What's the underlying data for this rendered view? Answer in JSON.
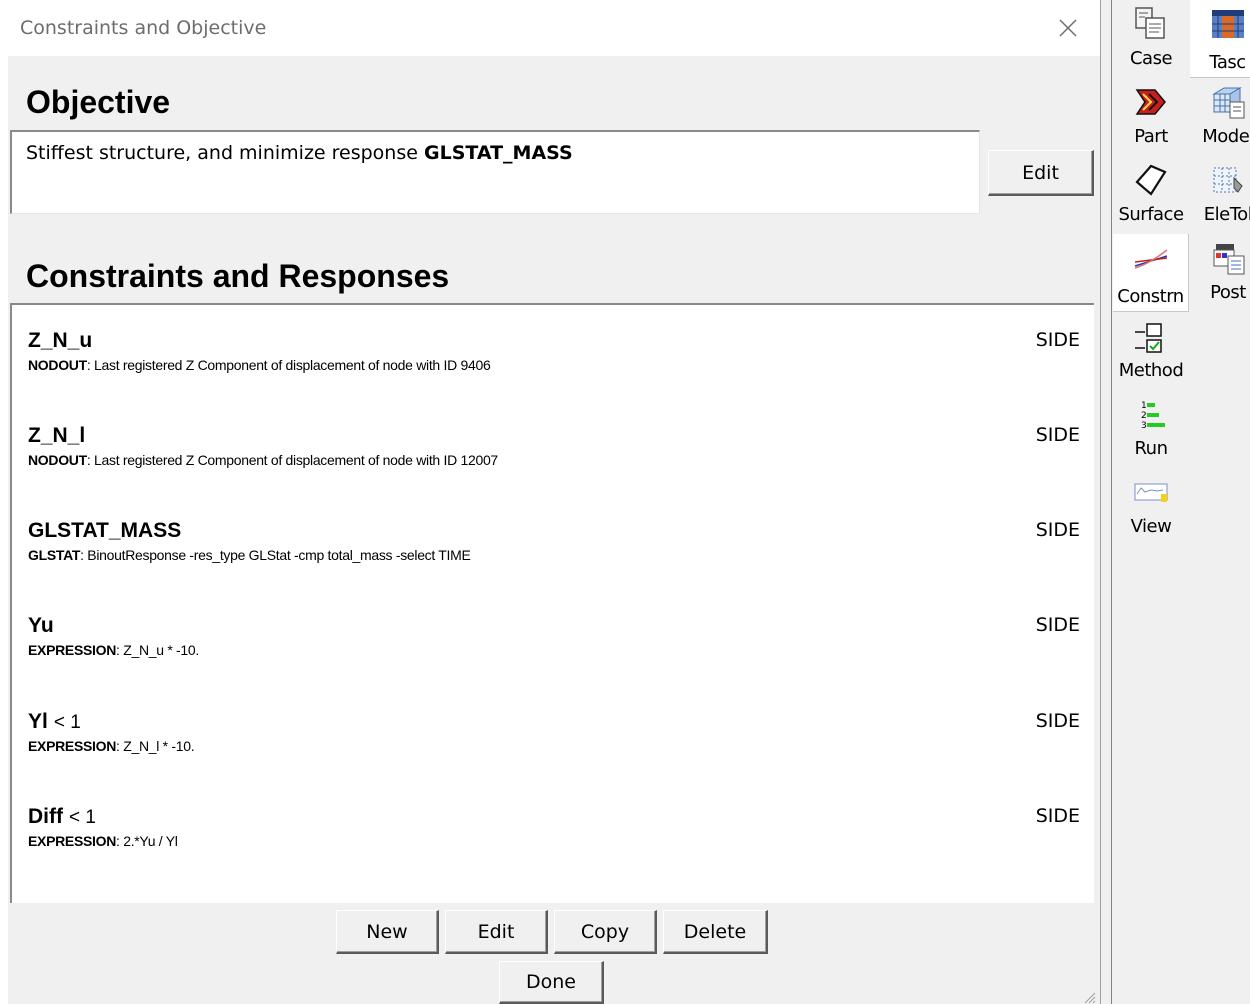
{
  "window": {
    "title": "Constraints and Objective"
  },
  "objective": {
    "heading": "Objective",
    "text_prefix": "Stiffest structure, and minimize response",
    "text_response": "GLSTAT_MASS",
    "edit_label": "Edit"
  },
  "constraints": {
    "heading": "Constraints and Responses",
    "items": [
      {
        "name": "Z_N_u",
        "bound": "",
        "type": "NODOUT",
        "desc": ": Last registered Z Component of displacement of node with ID 9406",
        "side": "SIDE"
      },
      {
        "name": "Z_N_l",
        "bound": "",
        "type": "NODOUT",
        "desc": ": Last registered Z Component of displacement of node with ID 12007",
        "side": "SIDE"
      },
      {
        "name": "GLSTAT_MASS",
        "bound": "",
        "type": "GLSTAT",
        "desc": ": BinoutResponse -res_type GLStat -cmp total_mass -select TIME",
        "side": "SIDE"
      },
      {
        "name": "Yu",
        "bound": "",
        "type": "EXPRESSION",
        "desc": ": Z_N_u * -10.",
        "side": "SIDE"
      },
      {
        "name": "Yl",
        "bound": "< 1",
        "type": "EXPRESSION",
        "desc": ": Z_N_l * -10.",
        "side": "SIDE"
      },
      {
        "name": "Diff",
        "bound": "< 1",
        "type": "EXPRESSION",
        "desc": ": 2.*Yu / Yl",
        "side": "SIDE"
      }
    ]
  },
  "buttons": {
    "new": "New",
    "edit": "Edit",
    "copy": "Copy",
    "delete": "Delete",
    "done": "Done"
  },
  "toolbar": {
    "items": [
      {
        "label": "Case",
        "icon": "case-icon"
      },
      {
        "label": "Tasc",
        "icon": "tasc-icon"
      },
      {
        "label": "Part",
        "icon": "part-icon"
      },
      {
        "label": "Model",
        "icon": "model-icon"
      },
      {
        "label": "Surface",
        "icon": "surface-icon"
      },
      {
        "label": "EleTol",
        "icon": "eletol-icon"
      },
      {
        "label": "Constrn",
        "icon": "constrn-icon"
      },
      {
        "label": "Post",
        "icon": "post-icon"
      },
      {
        "label": "Method",
        "icon": "method-icon"
      },
      {
        "label": "Run",
        "icon": "run-icon"
      },
      {
        "label": "View",
        "icon": "view-icon"
      }
    ]
  }
}
